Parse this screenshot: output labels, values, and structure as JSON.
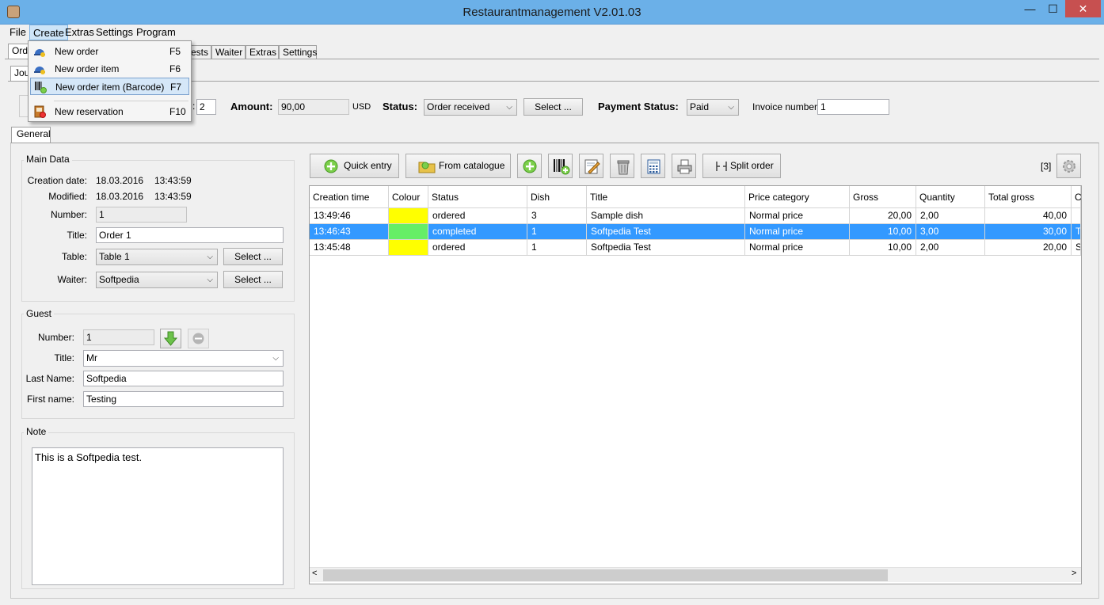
{
  "window": {
    "title": "Restaurantmanagement V2.01.03",
    "minimize": "—",
    "maximize": "☐",
    "close": "✕"
  },
  "menu": [
    "File",
    "Create",
    "Extras",
    "Settings",
    "Program"
  ],
  "create_menu": [
    {
      "label": "New order",
      "shortcut": "F5"
    },
    {
      "label": "New order item",
      "shortcut": "F6"
    },
    {
      "label": "New order item (Barcode)",
      "shortcut": "F7"
    },
    {
      "label": "New reservation",
      "shortcut": "F10"
    }
  ],
  "main_tabs": [
    "Ord",
    "ests",
    "Waiter",
    "Extras",
    "Settings"
  ],
  "sub_tab": "Jou",
  "order_header": {
    "number_value": "2",
    "amount_label": "Amount:",
    "amount_value": "90,00",
    "currency": "USD",
    "status_label": "Status:",
    "status_value": "Order received",
    "select_button": "Select ...",
    "payment_label": "Payment Status:",
    "payment_value": "Paid",
    "invoice_label": "Invoice number:",
    "invoice_value": "1"
  },
  "general_tab": "General",
  "main_data": {
    "title": "Main Data",
    "creation_label": "Creation date:",
    "creation_date": "18.03.2016",
    "creation_time": "13:43:59",
    "modified_label": "Modified:",
    "modified_date": "18.03.2016",
    "modified_time": "13:43:59",
    "number_label": "Number:",
    "number_value": "1",
    "title_label": "Title:",
    "title_value": "Order 1",
    "table_label": "Table:",
    "table_value": "Table 1",
    "waiter_label": "Waiter:",
    "waiter_value": "Softpedia",
    "select_button": "Select ..."
  },
  "guest": {
    "title": "Guest",
    "number_label": "Number:",
    "number_value": "1",
    "title_label": "Title:",
    "title_value": "Mr",
    "lastname_label": "Last Name:",
    "lastname_value": "Softpedia",
    "firstname_label": "First name:",
    "firstname_value": "Testing"
  },
  "note": {
    "title": "Note",
    "text": "This is a Softpedia test."
  },
  "toolbar": {
    "quick_entry": "Quick entry",
    "from_catalogue": "From catalogue",
    "split_order": "Split order",
    "count": "[3]"
  },
  "table": {
    "columns": [
      "Creation time",
      "Colour",
      "Status",
      "Dish",
      "Title",
      "Price category",
      "Gross",
      "Quantity",
      "Total gross",
      "C"
    ],
    "rows": [
      {
        "time": "13:49:46",
        "colour": "#ffff00",
        "status": "ordered",
        "dish": "3",
        "title": "Sample dish",
        "price_cat": "Normal price",
        "gross": "20,00",
        "qty": "2,00",
        "total": "40,00",
        "extra": "",
        "selected": false
      },
      {
        "time": "13:46:43",
        "colour": "#66ee66",
        "status": "completed",
        "dish": "1",
        "title": "Softpedia Test",
        "price_cat": "Normal price",
        "gross": "10,00",
        "qty": "3,00",
        "total": "30,00",
        "extra": "T",
        "selected": true
      },
      {
        "time": "13:45:48",
        "colour": "#ffff00",
        "status": "ordered",
        "dish": "1",
        "title": "Softpedia Test",
        "price_cat": "Normal price",
        "gross": "10,00",
        "qty": "2,00",
        "total": "20,00",
        "extra": "S",
        "selected": false
      }
    ]
  },
  "icons": {
    "order": "order-icon",
    "barcode": "barcode-icon",
    "reservation": "reservation-icon",
    "add": "add-icon",
    "edit": "edit-icon",
    "trash": "trash-icon",
    "calculator": "calculator-icon",
    "print": "print-icon",
    "settings": "gear-icon"
  }
}
